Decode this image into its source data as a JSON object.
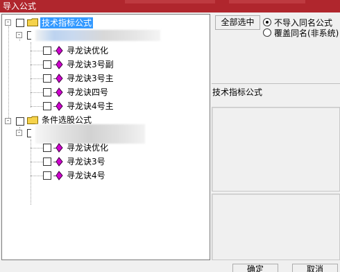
{
  "window": {
    "title": "导入公式"
  },
  "tree": {
    "groups": [
      {
        "label": "技术指标公式",
        "expander": "-",
        "children": [
          {
            "label": "寻龙诀优化"
          },
          {
            "label": "寻龙诀3号副"
          },
          {
            "label": "寻龙诀3号主"
          },
          {
            "label": "寻龙诀四号"
          },
          {
            "label": "寻龙诀4号主"
          }
        ]
      },
      {
        "label": "条件选股公式",
        "expander": "-",
        "children": [
          {
            "label": "寻龙诀优化"
          },
          {
            "label": "寻龙诀3号"
          },
          {
            "label": "寻龙诀4号"
          }
        ]
      }
    ]
  },
  "options": {
    "select_all_label": "全部选中",
    "radio_no_import": "不导入同名公式",
    "radio_overwrite": "覆盖同名(非系统)",
    "selected": "no_import"
  },
  "detail": {
    "formula_type": "技术指标公式"
  },
  "footer": {
    "ok_label": "确定",
    "cancel_label": "取消"
  },
  "colors": {
    "titlebar": "#b0262d",
    "selection": "#3399ff",
    "diamond": "#d000d0",
    "folder": "#f5d24a"
  }
}
